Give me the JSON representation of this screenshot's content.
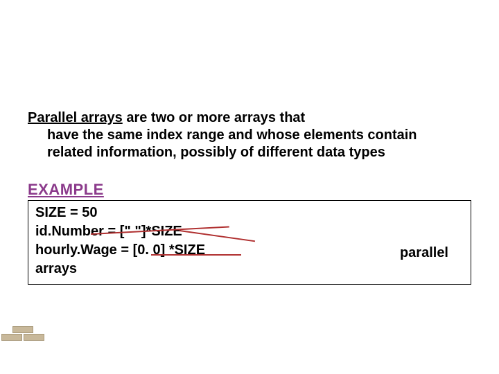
{
  "definition": {
    "term": "Parallel arrays",
    "rest_line1": " are two or more arrays that",
    "cont": "have the same index range and whose elements contain related information, possibly of different data types"
  },
  "example": {
    "heading": "EXAMPLE",
    "line1": "SIZE = 50",
    "line2": "id.Number = [\" \"]*SIZE",
    "line3": "hourly.Wage = [0. 0] *SIZE",
    "line4": "arrays",
    "parallel_label": "parallel"
  }
}
